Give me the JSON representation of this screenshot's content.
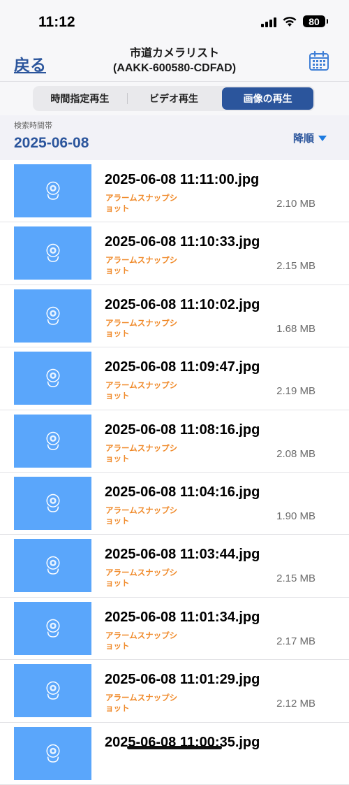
{
  "status": {
    "time": "11:12",
    "battery": "80"
  },
  "nav": {
    "back_label": "戻る",
    "title_line1": "市道カメラリスト",
    "title_line2": "(AAKK-600580-CDFAD)"
  },
  "tabs": [
    {
      "label": "時間指定再生",
      "active": false
    },
    {
      "label": "ビデオ再生",
      "active": false
    },
    {
      "label": "画像の再生",
      "active": true
    }
  ],
  "search": {
    "label": "検索時間帯",
    "date": "2025-06-08",
    "sort_label": "降順"
  },
  "colors": {
    "accent": "#2b559c",
    "thumbnail": "#5aa6fb",
    "type_label": "#f08a2a"
  },
  "files": [
    {
      "name": "2025-06-08  11:11:00.jpg",
      "type": "アラームスナップショット",
      "size": "2.10 MB"
    },
    {
      "name": "2025-06-08  11:10:33.jpg",
      "type": "アラームスナップショット",
      "size": "2.15 MB"
    },
    {
      "name": "2025-06-08  11:10:02.jpg",
      "type": "アラームスナップショット",
      "size": "1.68 MB"
    },
    {
      "name": "2025-06-08  11:09:47.jpg",
      "type": "アラームスナップショット",
      "size": "2.19 MB"
    },
    {
      "name": "2025-06-08  11:08:16.jpg",
      "type": "アラームスナップショット",
      "size": "2.08 MB"
    },
    {
      "name": "2025-06-08  11:04:16.jpg",
      "type": "アラームスナップショット",
      "size": "1.90 MB"
    },
    {
      "name": "2025-06-08  11:03:44.jpg",
      "type": "アラームスナップショット",
      "size": "2.15 MB"
    },
    {
      "name": "2025-06-08  11:01:34.jpg",
      "type": "アラームスナップショット",
      "size": "2.17 MB"
    },
    {
      "name": "2025-06-08  11:01:29.jpg",
      "type": "アラームスナップショット",
      "size": "2.12 MB"
    },
    {
      "name": "2025-06-08  11:00:35.jpg",
      "type": "",
      "size": ""
    }
  ]
}
